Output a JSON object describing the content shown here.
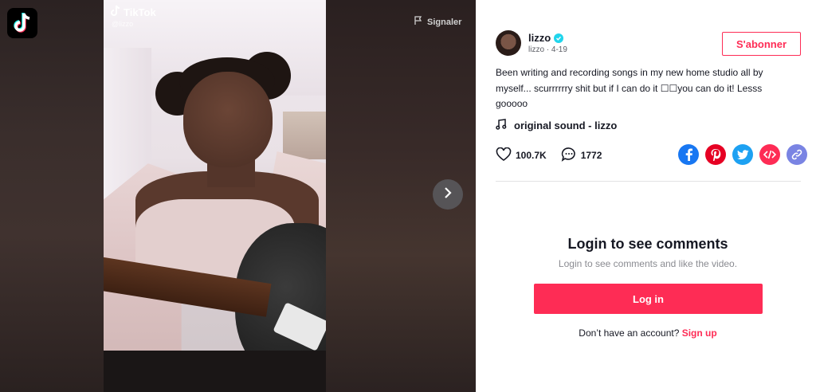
{
  "video": {
    "brand": "TikTok",
    "handle": "@lizzo",
    "report_label": "Signaler"
  },
  "author": {
    "name": "lizzo",
    "subtitle": "lizzo · 4-19",
    "follow_label": "S'abonner"
  },
  "post": {
    "description": "Been writing and recording songs in my new home studio all by myself... scurrrrrry shit but if I can do it ☐☐you can do it! Lesss gooooo",
    "sound": "original sound - lizzo",
    "likes": "100.7K",
    "comments": "1772"
  },
  "share": [
    {
      "name": "facebook-icon",
      "color": "#1877f2"
    },
    {
      "name": "pinterest-icon",
      "color": "#e60023"
    },
    {
      "name": "twitter-icon",
      "color": "#1da1f2"
    },
    {
      "name": "embed-icon",
      "color": "#fe2c55"
    },
    {
      "name": "link-icon",
      "color": "#7a84e3"
    }
  ],
  "comments_section": {
    "title": "Login to see comments",
    "subtitle": "Login to see comments and like the video.",
    "login_label": "Log in",
    "signup_prompt": "Don’t have an account?",
    "signup_label": "Sign up"
  }
}
